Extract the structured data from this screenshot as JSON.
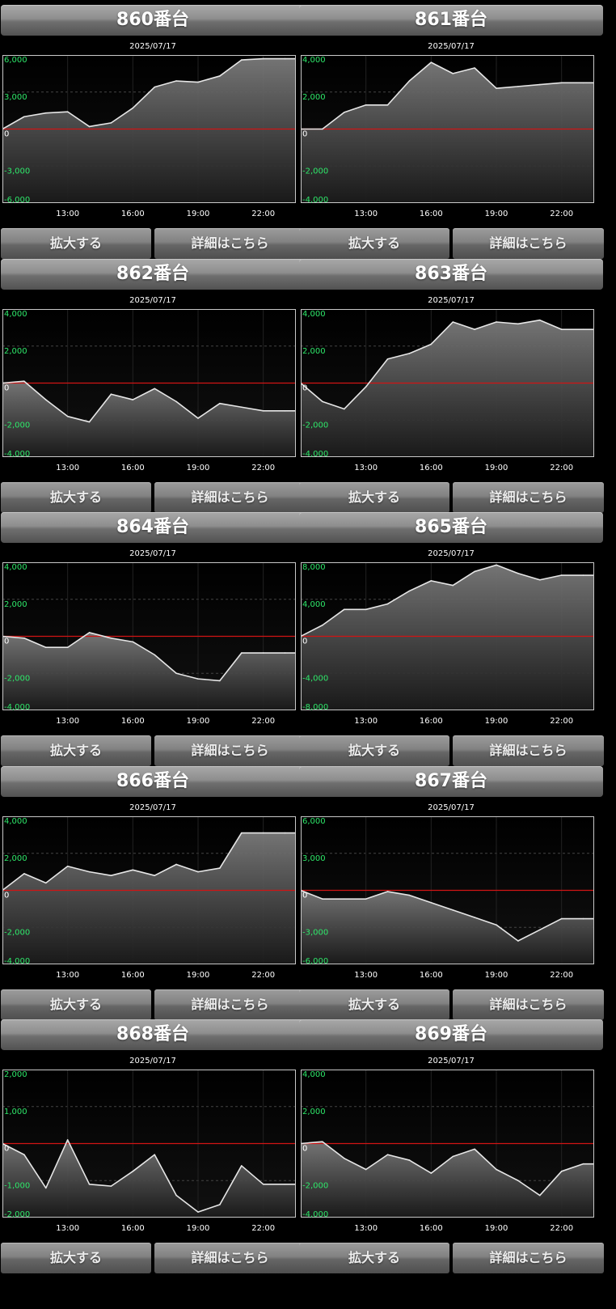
{
  "panels": [
    {
      "title": "860番台",
      "date": "2025/07/17",
      "zoom_label": "拡大する",
      "detail_label": "詳細はこちら",
      "chart_data": {
        "type": "area",
        "x_ticks": [
          "13:00",
          "16:00",
          "19:00",
          "22:00"
        ],
        "y_ticks": [
          "6,000",
          "3,000",
          "0",
          "-3,000",
          "-6,000"
        ],
        "ylim": [
          -6000,
          6000
        ],
        "x": [
          10,
          11,
          12,
          13,
          14,
          15,
          16,
          17,
          18,
          19,
          20,
          21,
          22,
          23
        ],
        "values": [
          0,
          1000,
          1300,
          1400,
          200,
          500,
          1700,
          3400,
          3900,
          3800,
          4300,
          5600,
          5700,
          5700
        ]
      }
    },
    {
      "title": "861番台",
      "date": "2025/07/17",
      "zoom_label": "拡大する",
      "detail_label": "詳細はこちら",
      "chart_data": {
        "type": "area",
        "x_ticks": [
          "13:00",
          "16:00",
          "19:00",
          "22:00"
        ],
        "y_ticks": [
          "4,000",
          "2,000",
          "0",
          "-2,000",
          "-4,000"
        ],
        "ylim": [
          -4000,
          4000
        ],
        "x": [
          10,
          11,
          12,
          13,
          14,
          15,
          16,
          17,
          18,
          19,
          20,
          21,
          22,
          23
        ],
        "values": [
          0,
          0,
          900,
          1300,
          1300,
          2600,
          3600,
          3000,
          3300,
          2200,
          2300,
          2400,
          2500,
          2500
        ]
      }
    },
    {
      "title": "862番台",
      "date": "2025/07/17",
      "zoom_label": "拡大する",
      "detail_label": "詳細はこちら",
      "chart_data": {
        "type": "area",
        "x_ticks": [
          "13:00",
          "16:00",
          "19:00",
          "22:00"
        ],
        "y_ticks": [
          "4,000",
          "2,000",
          "0",
          "-2,000",
          "-4,000"
        ],
        "ylim": [
          -4000,
          4000
        ],
        "x": [
          10,
          11,
          12,
          13,
          14,
          15,
          16,
          17,
          18,
          19,
          20,
          21,
          22,
          23
        ],
        "values": [
          0,
          100,
          -900,
          -1800,
          -2100,
          -600,
          -900,
          -300,
          -1000,
          -1900,
          -1100,
          -1300,
          -1500,
          -1500
        ]
      }
    },
    {
      "title": "863番台",
      "date": "2025/07/17",
      "zoom_label": "拡大する",
      "detail_label": "詳細はこちら",
      "chart_data": {
        "type": "area",
        "x_ticks": [
          "13:00",
          "16:00",
          "19:00",
          "22:00"
        ],
        "y_ticks": [
          "4,000",
          "2,000",
          "0",
          "-2,000",
          "-4,000"
        ],
        "ylim": [
          -4000,
          4000
        ],
        "x": [
          10,
          11,
          12,
          13,
          14,
          15,
          16,
          17,
          18,
          19,
          20,
          21,
          22,
          23
        ],
        "values": [
          0,
          -1000,
          -1400,
          -200,
          1300,
          1600,
          2100,
          3300,
          2900,
          3300,
          3200,
          3400,
          2900,
          2900
        ]
      }
    },
    {
      "title": "864番台",
      "date": "2025/07/17",
      "zoom_label": "拡大する",
      "detail_label": "詳細はこちら",
      "chart_data": {
        "type": "area",
        "x_ticks": [
          "13:00",
          "16:00",
          "19:00",
          "22:00"
        ],
        "y_ticks": [
          "4,000",
          "2,000",
          "0",
          "-2,000",
          "-4,000"
        ],
        "ylim": [
          -4000,
          4000
        ],
        "x": [
          10,
          11,
          12,
          13,
          14,
          15,
          16,
          17,
          18,
          19,
          20,
          21,
          22,
          23
        ],
        "values": [
          0,
          -100,
          -600,
          -600,
          200,
          -100,
          -300,
          -1000,
          -2000,
          -2300,
          -2400,
          -900,
          -900,
          -900
        ]
      }
    },
    {
      "title": "865番台",
      "date": "2025/07/17",
      "zoom_label": "拡大する",
      "detail_label": "詳細はこちら",
      "chart_data": {
        "type": "area",
        "x_ticks": [
          "13:00",
          "16:00",
          "19:00",
          "22:00"
        ],
        "y_ticks": [
          "8,000",
          "4,000",
          "0",
          "-4,000",
          "-8,000"
        ],
        "ylim": [
          -8000,
          8000
        ],
        "x": [
          10,
          11,
          12,
          13,
          14,
          15,
          16,
          17,
          18,
          19,
          20,
          21,
          22,
          23
        ],
        "values": [
          0,
          1200,
          2900,
          2900,
          3500,
          4900,
          6000,
          5500,
          7000,
          7700,
          6800,
          6100,
          6600,
          6600
        ]
      }
    },
    {
      "title": "866番台",
      "date": "2025/07/17",
      "zoom_label": "拡大する",
      "detail_label": "詳細はこちら",
      "chart_data": {
        "type": "area",
        "x_ticks": [
          "13:00",
          "16:00",
          "19:00",
          "22:00"
        ],
        "y_ticks": [
          "4,000",
          "2,000",
          "0",
          "-2,000",
          "-4,000"
        ],
        "ylim": [
          -4000,
          4000
        ],
        "x": [
          10,
          11,
          12,
          13,
          14,
          15,
          16,
          17,
          18,
          19,
          20,
          21,
          22,
          23
        ],
        "values": [
          0,
          900,
          400,
          1300,
          1000,
          800,
          1100,
          800,
          1400,
          1000,
          1200,
          3100,
          3100,
          3100
        ]
      }
    },
    {
      "title": "867番台",
      "date": "2025/07/17",
      "zoom_label": "拡大する",
      "detail_label": "詳細はこちら",
      "chart_data": {
        "type": "area",
        "x_ticks": [
          "13:00",
          "16:00",
          "19:00",
          "22:00"
        ],
        "y_ticks": [
          "6,000",
          "3,000",
          "0",
          "-3,000",
          "-6,000"
        ],
        "ylim": [
          -6000,
          6000
        ],
        "x": [
          10,
          11,
          12,
          13,
          14,
          15,
          16,
          17,
          18,
          19,
          20,
          21,
          22,
          23
        ],
        "values": [
          0,
          -700,
          -700,
          -700,
          -100,
          -400,
          -1000,
          -1600,
          -2200,
          -2800,
          -4100,
          -3200,
          -2300,
          -2300
        ]
      }
    },
    {
      "title": "868番台",
      "date": "2025/07/17",
      "zoom_label": "拡大する",
      "detail_label": "詳細はこちら",
      "chart_data": {
        "type": "area",
        "x_ticks": [
          "13:00",
          "16:00",
          "19:00",
          "22:00"
        ],
        "y_ticks": [
          "2,000",
          "1,000",
          "0",
          "-1,000",
          "-2,000"
        ],
        "ylim": [
          -2000,
          2000
        ],
        "x": [
          10,
          11,
          12,
          13,
          14,
          15,
          16,
          17,
          18,
          19,
          20,
          21,
          22,
          23
        ],
        "values": [
          0,
          -300,
          -1200,
          100,
          -1100,
          -1150,
          -750,
          -300,
          -1400,
          -1850,
          -1650,
          -600,
          -1100,
          -1100
        ]
      }
    },
    {
      "title": "869番台",
      "date": "2025/07/17",
      "zoom_label": "拡大する",
      "detail_label": "詳細はこちら",
      "chart_data": {
        "type": "area",
        "x_ticks": [
          "13:00",
          "16:00",
          "19:00",
          "22:00"
        ],
        "y_ticks": [
          "4,000",
          "2,000",
          "0",
          "-2,000",
          "-4,000"
        ],
        "ylim": [
          -4000,
          4000
        ],
        "x": [
          10,
          11,
          12,
          13,
          14,
          15,
          16,
          17,
          18,
          19,
          20,
          21,
          22,
          23
        ],
        "values": [
          0,
          100,
          -800,
          -1400,
          -600,
          -900,
          -1600,
          -700,
          -300,
          -1400,
          -2000,
          -2800,
          -1500,
          -1100
        ]
      }
    }
  ],
  "colors": {
    "line": "#e6e6e6",
    "zero_line": "#d11414",
    "tick_text_y": "#2ee86a",
    "tick_text_x": "#ffffff",
    "frame": "#c8c8c8",
    "grid": "#444444"
  }
}
